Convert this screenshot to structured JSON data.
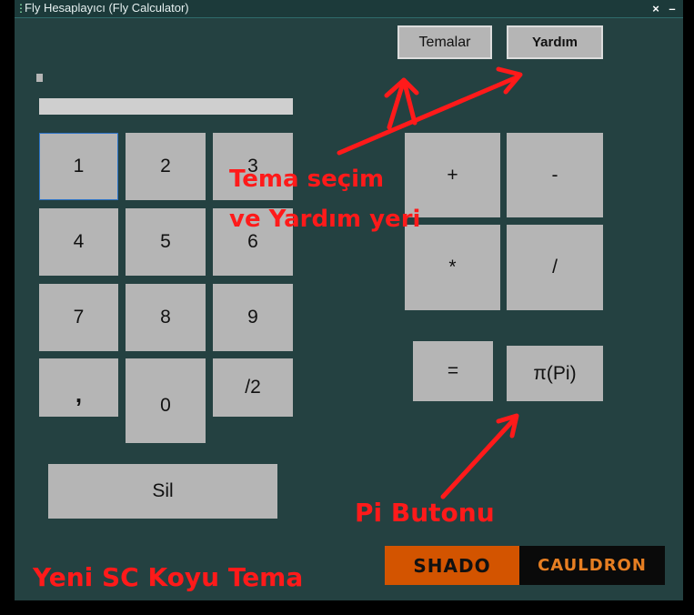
{
  "window": {
    "title": "Fly Hesaplayıcı (Fly Calculator)",
    "close_symbol": "×",
    "minimize_symbol": "–"
  },
  "top_buttons": {
    "themes_label": "Temalar",
    "help_label": "Yardım"
  },
  "display": {
    "value": ""
  },
  "keypad": {
    "digits": [
      "1",
      "2",
      "3",
      "4",
      "5",
      "6",
      "7",
      "8",
      "9",
      ",",
      "0",
      "/2"
    ],
    "clear_label": "Sil"
  },
  "operators": {
    "plus": "+",
    "minus": "-",
    "multiply": "*",
    "divide": "/",
    "equals": "=",
    "pi": "π(Pi)"
  },
  "annotations": {
    "theme_help_line1": "Tema seçim",
    "theme_help_line2": "ve Yardım yeri",
    "pi_button": "Pi Butonu",
    "new_theme": "Yeni SC Koyu Tema"
  },
  "logo": {
    "left_text": "SHADO",
    "right_text": "CAULDRON"
  },
  "colors": {
    "background": "#244141",
    "button": "#b5b5b5",
    "annotation": "#ff1a1a",
    "logo_left_bg": "#d35400",
    "logo_right_text": "#e67e22"
  }
}
